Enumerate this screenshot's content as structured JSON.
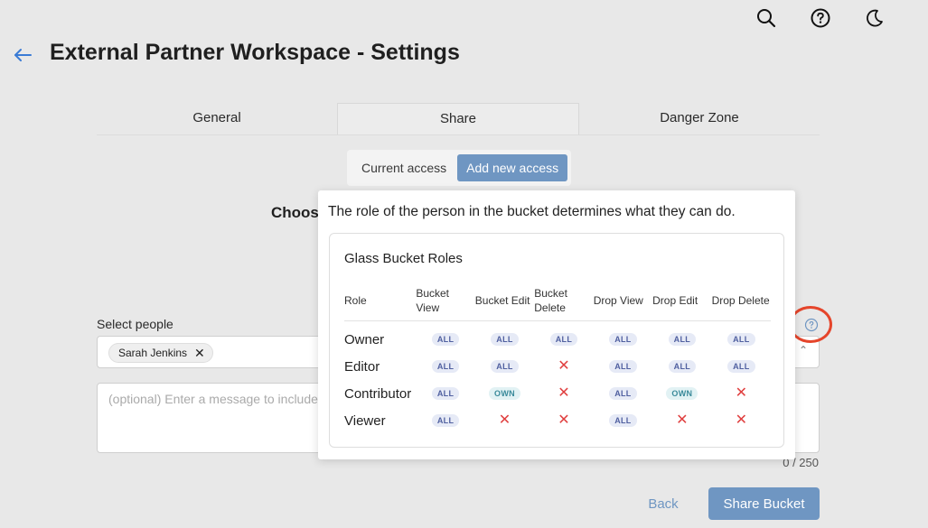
{
  "header": {
    "title": "External Partner Workspace - Settings",
    "icons": [
      "search-icon",
      "help-circle-icon",
      "moon-icon",
      "arrow-left-icon"
    ]
  },
  "tabs": [
    {
      "label": "General",
      "active": false
    },
    {
      "label": "Share",
      "active": true
    },
    {
      "label": "Danger Zone",
      "active": false
    }
  ],
  "segment": {
    "current": "Current access",
    "add": "Add new access"
  },
  "choose_heading": "Choos",
  "select_people": {
    "label": "Select people",
    "chips": [
      "Sarah Jenkins"
    ]
  },
  "message": {
    "placeholder": "(optional) Enter a message to include",
    "counter": "0 / 250"
  },
  "actions": {
    "back": "Back",
    "share": "Share Bucket"
  },
  "popover": {
    "description": "The role of the person in the bucket determines what they can do.",
    "card_title": "Glass Bucket Roles",
    "headers": [
      "Role",
      "Bucket View",
      "Bucket Edit",
      "Bucket Delete",
      "Drop View",
      "Drop Edit",
      "Drop Delete"
    ],
    "rows": [
      {
        "role": "Owner",
        "perms": [
          "ALL",
          "ALL",
          "ALL",
          "ALL",
          "ALL",
          "ALL"
        ]
      },
      {
        "role": "Editor",
        "perms": [
          "ALL",
          "ALL",
          "x",
          "ALL",
          "ALL",
          "ALL"
        ]
      },
      {
        "role": "Contributor",
        "perms": [
          "ALL",
          "OWN",
          "x",
          "ALL",
          "OWN",
          "x"
        ]
      },
      {
        "role": "Viewer",
        "perms": [
          "ALL",
          "x",
          "x",
          "ALL",
          "x",
          "x"
        ]
      }
    ]
  },
  "colors": {
    "accent": "#6f96c2",
    "highlight_ring": "#e5452b",
    "deny": "#e04040"
  }
}
